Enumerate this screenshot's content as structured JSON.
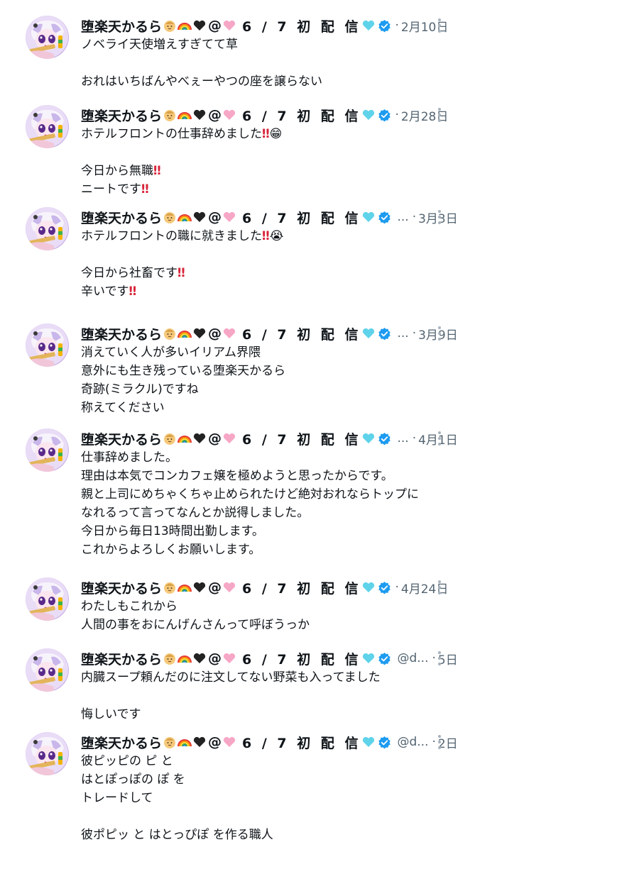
{
  "author": {
    "name": "堕楽天かるら",
    "at": "@",
    "live_label": "6 / 7 初 配 信",
    "truncation": "...",
    "emoji_icons": [
      "baby-face-emoji",
      "rainbow-emoji",
      "black-heart-emoji",
      "pink-heart-emoji",
      "light-blue-heart-emoji"
    ]
  },
  "colors": {
    "verified": "#1d9bf0",
    "secondary_text": "#536471",
    "exclamation": "#d8243a",
    "dots": "#a8b3bd"
  },
  "tweets": [
    {
      "handle": "",
      "date": "2月10日",
      "lines": [
        "ノベライ天使増えすぎてて草",
        "",
        "おれはいちばんやべぇーやつの座を譲らない"
      ]
    },
    {
      "handle": "",
      "date": "2月28日",
      "lines": [
        "ホテルフロントの仕事辞めました‼😁",
        "",
        "今日から無職‼",
        "ニートです‼"
      ]
    },
    {
      "handle": "...",
      "date": "3月3日",
      "lines": [
        "ホテルフロントの職に就きました‼😭",
        "",
        "今日から社畜です‼",
        "辛いです‼"
      ]
    },
    {
      "handle": "...",
      "date": "3月9日",
      "lines": [
        "消えていく人が多いイリアム界隈",
        "意外にも生き残っている堕楽天かるら",
        "奇跡(ミラクル)ですね",
        "称えてください"
      ]
    },
    {
      "handle": "...",
      "date": "4月1日",
      "lines": [
        "仕事辞めました。",
        "理由は本気でコンカフェ嬢を極めようと思ったからです。",
        "親と上司にめちゃくちゃ止められたけど絶対おれならトップに",
        "なれるって言ってなんとか説得しました。",
        "今日から毎日13時間出勤します。",
        "これからよろしくお願いします。"
      ]
    },
    {
      "handle": "",
      "date": "4月24日",
      "lines": [
        "わたしもこれから",
        "人間の事をおにんげんさんって呼ぼうっか"
      ]
    },
    {
      "handle": "@d...",
      "date": "5日",
      "lines": [
        "内臓スープ頼んだのに注文してない野菜も入ってました",
        "",
        "悔しいです"
      ]
    },
    {
      "handle": "@d...",
      "date": "2日",
      "lines": [
        "彼ピッピの ピ と",
        "はとぽっぽの ぽ を",
        "トレードして",
        "",
        "彼ポピッ と はとっぴぽ を作る職人"
      ]
    }
  ]
}
